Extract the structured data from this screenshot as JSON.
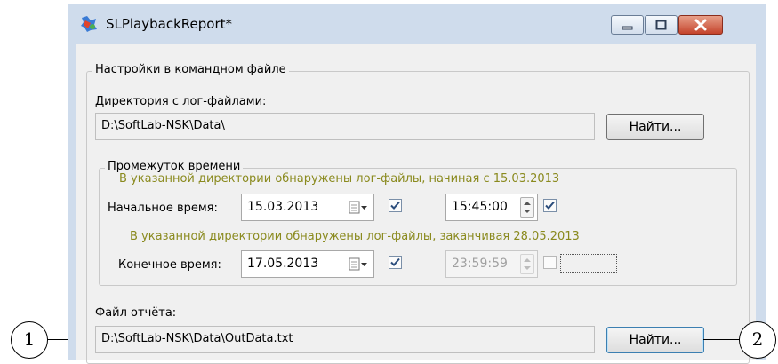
{
  "window": {
    "title": "SLPlaybackReport*"
  },
  "settings": {
    "group_title": "Настройки в командном файле",
    "log_dir_label": "Директория с лог-файлами:",
    "log_dir_value": "D:\\SoftLab-NSK\\Data\\",
    "browse_label": "Найти...",
    "time_group_title": "Промежуток времени",
    "start_note": "В указанной директории обнаружены лог-файлы, начиная с 15.03.2013",
    "start_label": "Начальное время:",
    "start_date": "15.03.2013",
    "start_time": "15:45:00",
    "end_note": "В указанной директории обнаружены лог-файлы, заканчивая 28.05.2013",
    "end_label": "Конечное время:",
    "end_date": "17.05.2013",
    "end_time": "23:59:59",
    "report_label": "Файл отчёта:",
    "report_value": "D:\\SoftLab-NSK\\Data\\OutData.txt",
    "report_browse_label": "Найти..."
  },
  "checkboxes": {
    "start_date_checked": true,
    "start_time_checked": true,
    "end_date_checked": true,
    "end_time_checked": false
  },
  "callouts": {
    "left": "1",
    "right": "2"
  },
  "colors": {
    "note_text": "#8a8a1e",
    "close_button": "#c4432b",
    "frame": "#cfdcec"
  }
}
